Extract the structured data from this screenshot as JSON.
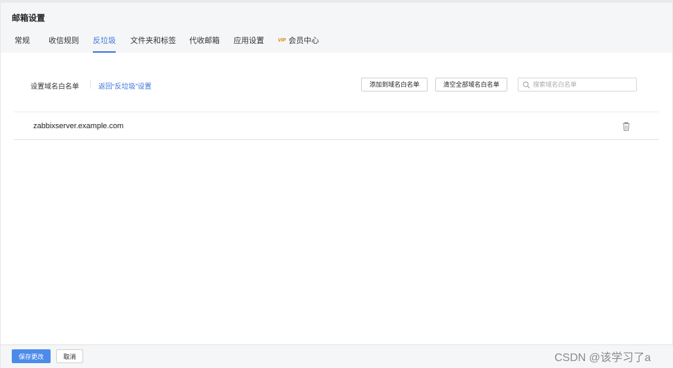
{
  "page": {
    "title": "邮箱设置"
  },
  "tabs": [
    {
      "label": "常规",
      "active": false
    },
    {
      "label": "收信规则",
      "active": false
    },
    {
      "label": "反垃圾",
      "active": true
    },
    {
      "label": "文件夹和标签",
      "active": false
    },
    {
      "label": "代收邮箱",
      "active": false
    },
    {
      "label": "应用设置",
      "active": false
    },
    {
      "label": "会员中心",
      "active": false,
      "badge": "vip"
    }
  ],
  "toolbar": {
    "label": "设置域名白名单",
    "back_link": "返回“反垃圾”设置",
    "add_button": "添加到域名白名单",
    "clear_button": "清空全部域名白名单",
    "search_placeholder": "搜索域名白名单"
  },
  "whitelist": [
    {
      "domain": "zabbixserver.example.com"
    }
  ],
  "footer": {
    "save_button": "保存更改",
    "cancel_button": "取消"
  },
  "watermark": "CSDN @该学习了a",
  "colors": {
    "accent": "#3b74d9",
    "primary_button": "#4d8bea",
    "header_bg": "#f5f6f8"
  }
}
